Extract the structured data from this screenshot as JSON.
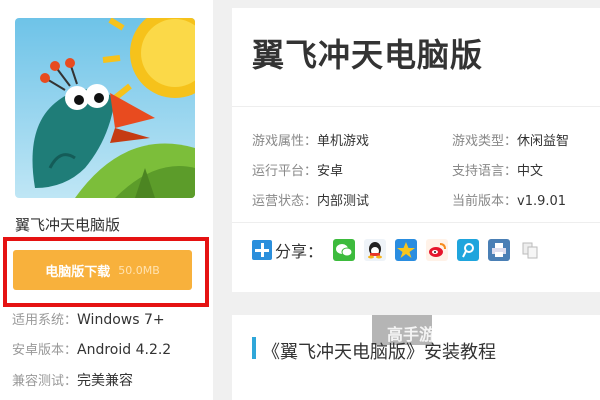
{
  "app": {
    "name": "翼飞冲天电脑版",
    "download_label": "电脑版下载",
    "download_size": "50.0MB"
  },
  "specs": [
    {
      "key": "适用系统：",
      "value": "Windows 7+"
    },
    {
      "key": "安卓版本：",
      "value": "Android 4.2.2"
    },
    {
      "key": "兼容测试：",
      "value": "完美兼容"
    }
  ],
  "detail": {
    "title": "翼飞冲天电脑版",
    "attributes": [
      {
        "key": "游戏属性：",
        "value": "单机游戏"
      },
      {
        "key": "游戏类型：",
        "value": "休闲益智"
      },
      {
        "key": "运行平台：",
        "value": "安卓"
      },
      {
        "key": "支持语言：",
        "value": "中文"
      },
      {
        "key": "运营状态：",
        "value": "内部测试"
      },
      {
        "key": "当前版本：",
        "value": "v1.9.01"
      }
    ],
    "share_label": "分享："
  },
  "share_icons": [
    "wechat-icon",
    "qq-icon",
    "qzone-icon",
    "weibo-icon",
    "tencent-weibo-icon",
    "print-icon",
    "copy-icon"
  ],
  "tutorial": {
    "title": "《翼飞冲天电脑版》安装教程"
  },
  "watermark": {
    "text": "高手游"
  },
  "colors": {
    "download_button": "#f8b13c",
    "highlight_border": "#e51212",
    "share_plus": "#2b8fdc",
    "tutorial_accent": "#2fa7d9"
  }
}
